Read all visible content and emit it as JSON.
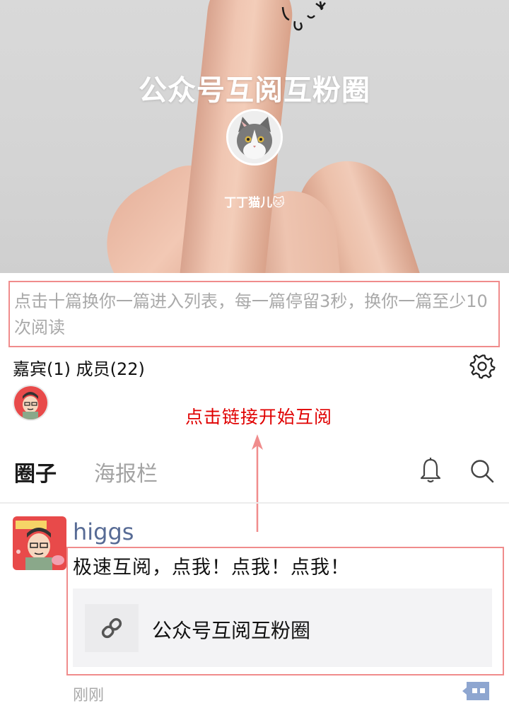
{
  "hero": {
    "title": "公众号互阅互粉圈",
    "owner_name": "丁丁猫儿🐱"
  },
  "notice": {
    "text": "点击十篇换你一篇进入列表，每一篇停留3秒，换你一篇至少10次阅读"
  },
  "members": {
    "summary": "嘉宾(1) 成员(22)"
  },
  "annotation": {
    "text": "点击链接开始互阅"
  },
  "tabs": [
    {
      "label": "圈子",
      "active": true
    },
    {
      "label": "海报栏",
      "active": false
    }
  ],
  "post": {
    "author": "higgs",
    "text": "极速互阅，点我！点我！点我！",
    "link_title": "公众号互阅互粉圈",
    "time": "刚刚"
  },
  "colors": {
    "highlight_border": "#f08c8c",
    "annotation_red": "#e00000",
    "author_blue": "#576b95",
    "muted_gray": "#a9a9a9",
    "comment_blue": "#8ea6d0"
  },
  "icons": [
    "gear-icon",
    "bell-icon",
    "search-icon",
    "link-icon",
    "comment-icon",
    "up-arrow-icon"
  ]
}
